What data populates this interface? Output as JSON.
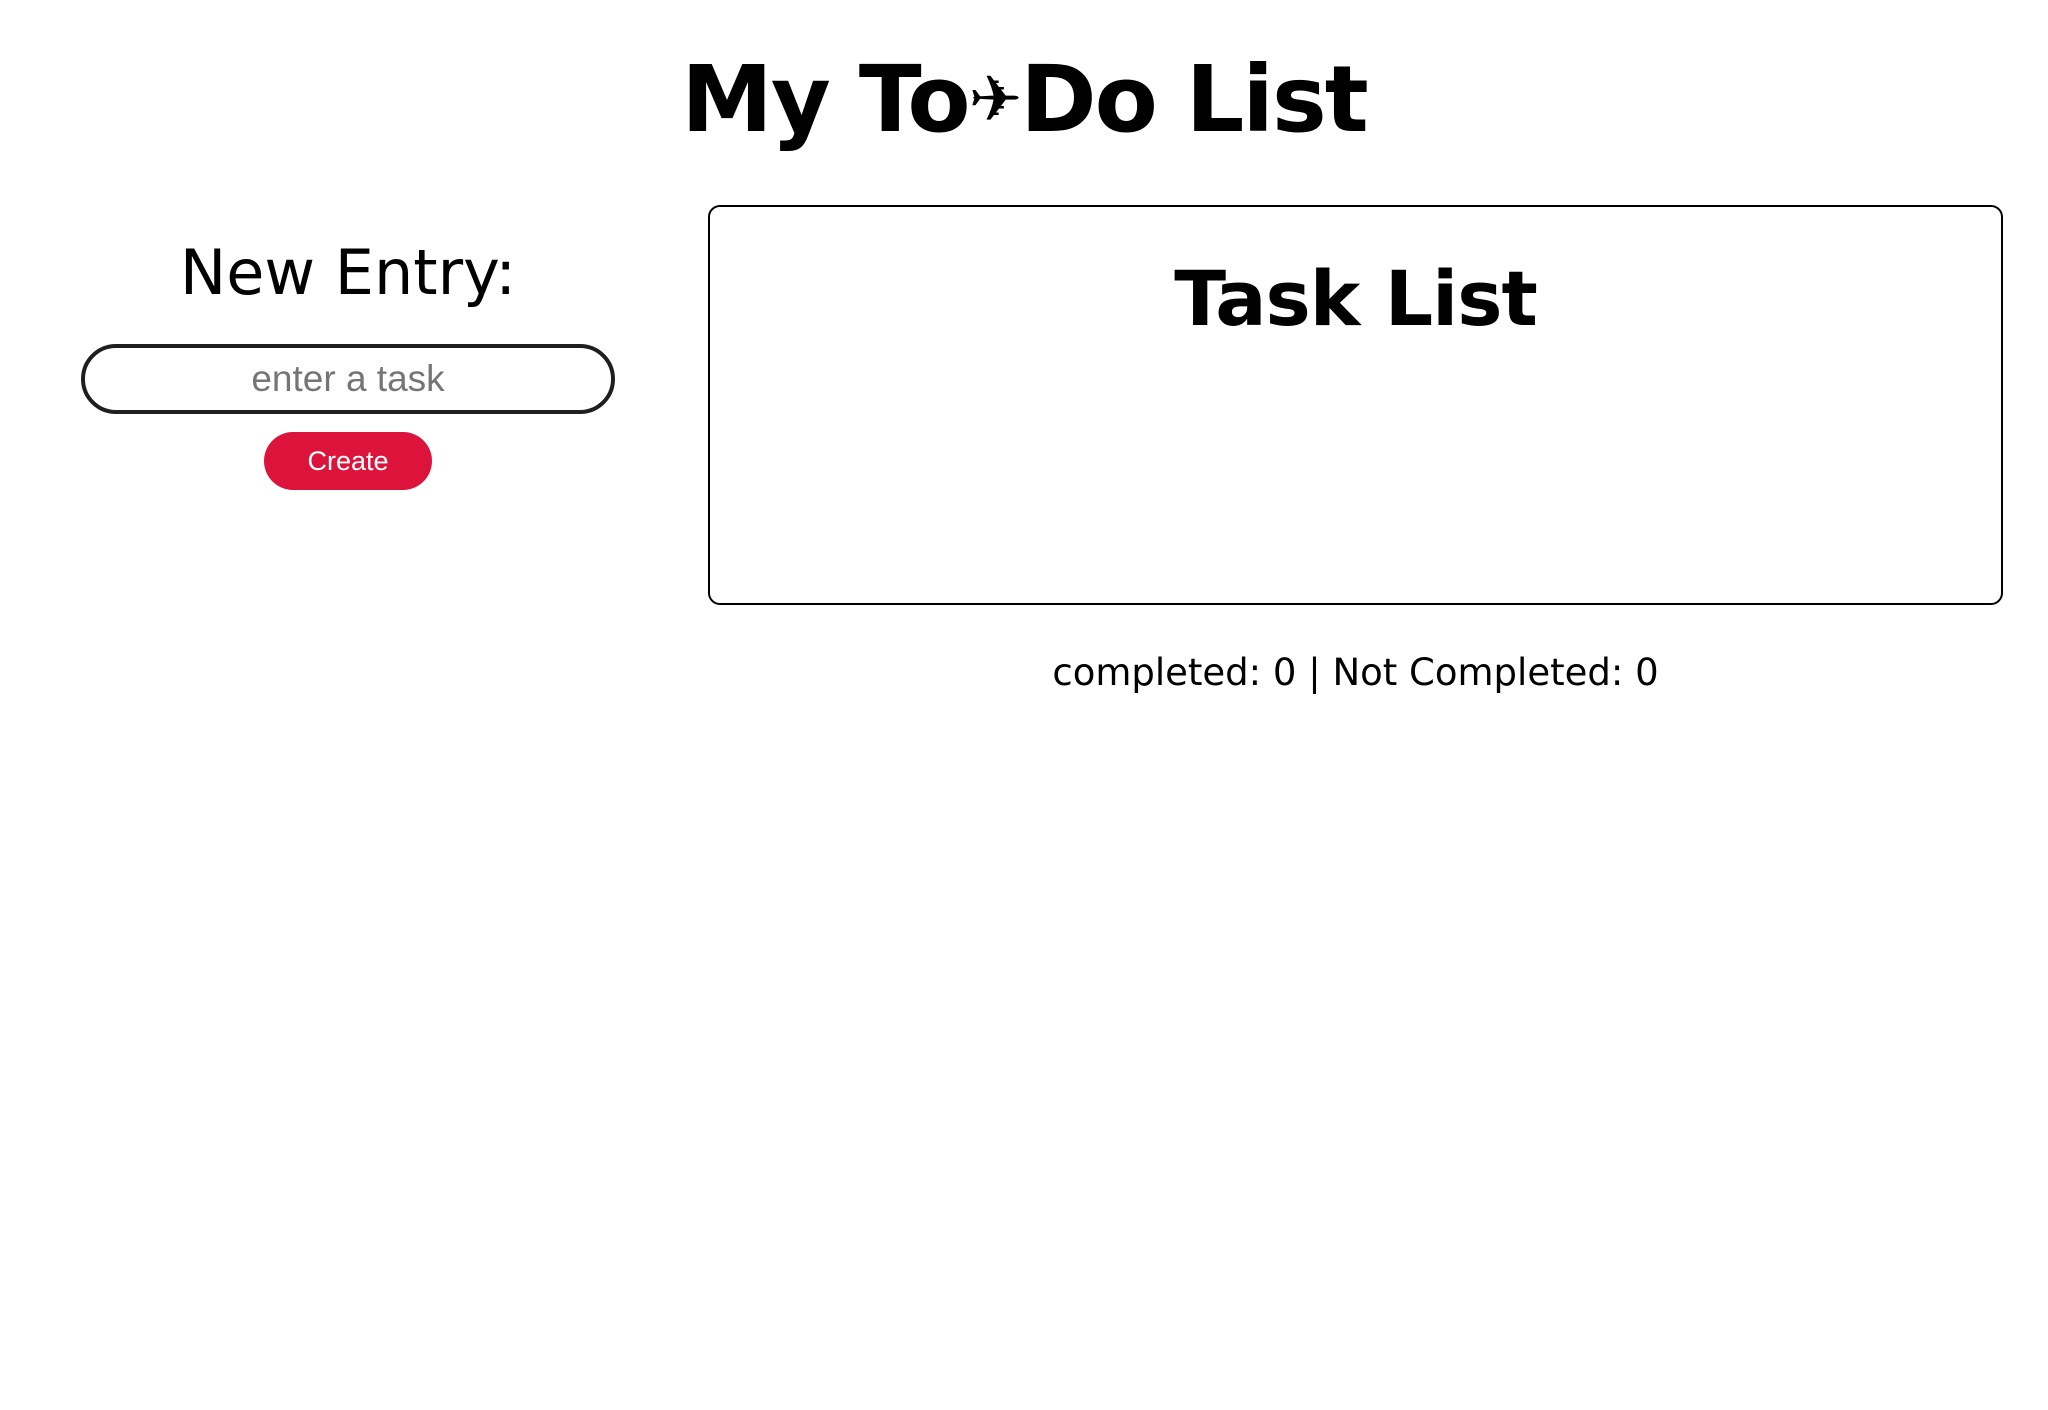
{
  "header": {
    "title_part1": "My To",
    "title_icon": "✈",
    "title_icon_name": "airplane-icon",
    "title_part2": "Do List"
  },
  "new_entry": {
    "heading": "New Entry:",
    "input_value": "",
    "input_placeholder": "enter a task",
    "create_label": "Create",
    "accent_color": "#dc143c"
  },
  "task_panel": {
    "heading": "Task List",
    "tasks": []
  },
  "status": {
    "completed_label": "completed:",
    "completed_count": "0",
    "separator": "|",
    "not_completed_label": "Not Completed:",
    "not_completed_count": "0"
  }
}
